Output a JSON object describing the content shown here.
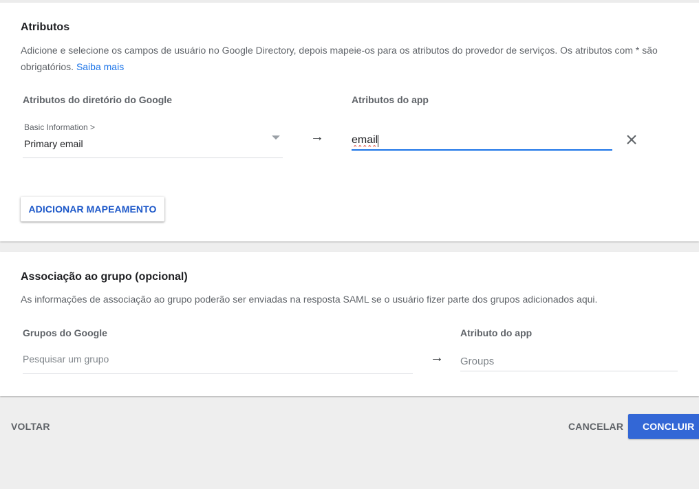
{
  "attributes": {
    "title": "Atributos",
    "description": "Adicione e selecione os campos de usuário no Google Directory, depois mapeie-os para os atributos do provedor de serviços. Os atributos com * são obrigatórios.",
    "learn_more": "Saiba mais",
    "directory_col_label": "Atributos do diretório do Google",
    "app_col_label": "Atributos do app",
    "mapping": {
      "select_category": "Basic Information >",
      "select_value": "Primary email",
      "arrow": "→",
      "app_value": "email"
    },
    "add_mapping_button": "ADICIONAR MAPEAMENTO"
  },
  "group_association": {
    "title": "Associação ao grupo (opcional)",
    "description": "As informações de associação ao grupo poderão ser enviadas na resposta SAML se o usuário fizer parte dos grupos adicionados aqui.",
    "google_groups_label": "Grupos do Google",
    "search_placeholder": "Pesquisar um grupo",
    "arrow": "→",
    "app_attribute_label": "Atributo do app",
    "app_attribute_placeholder": "Groups"
  },
  "footer": {
    "back": "VOLTAR",
    "cancel": "CANCELAR",
    "finish": "CONCLUIR"
  },
  "icons": {
    "remove": "close-icon",
    "dropdown": "chevron-down-icon"
  },
  "colors": {
    "primary": "#3367d6",
    "link": "#1a73e8"
  }
}
